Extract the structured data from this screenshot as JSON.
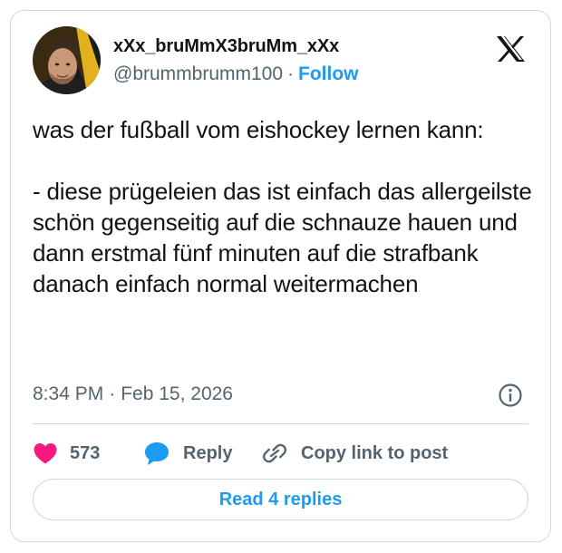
{
  "author": {
    "display_name": "xXx_bruMmX3bruMm_xXx",
    "handle": "@brummbrumm100",
    "separator": "·",
    "follow_label": "Follow"
  },
  "tweet": {
    "text": "was der fußball vom eishockey lernen kann:\n\n- diese prügeleien das ist einfach das allergeilste schön gegenseitig auf die schnauze hauen und dann erstmal fünf minuten auf die strafbank danach einfach normal weitermachen",
    "time": "8:34 PM",
    "separator": "·",
    "date": "Feb 15, 2026"
  },
  "actions": {
    "like_count": "573",
    "reply_label": "Reply",
    "copy_link_label": "Copy link to post"
  },
  "footer": {
    "read_replies_label": "Read 4 replies"
  },
  "icons": {
    "brand_logo": "x-logo-icon",
    "info": "info-icon",
    "like": "heart-icon",
    "reply": "speech-bubble-icon",
    "copy_link": "link-icon"
  },
  "colors": {
    "accent": "#1d9bf0",
    "like": "#f91880",
    "text": "#0f1419",
    "secondary_text": "#536471",
    "border": "#cfd9de"
  }
}
